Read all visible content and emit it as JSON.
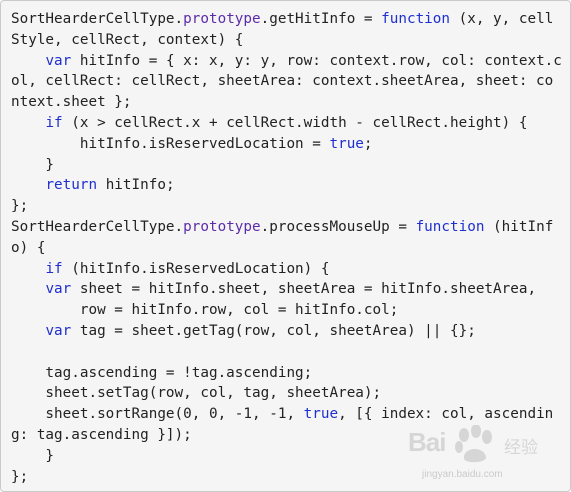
{
  "code": {
    "lines": [
      [
        {
          "t": "SortHearderCellType."
        },
        {
          "t": "prototype",
          "c": "prop"
        },
        {
          "t": ".getHitInfo = "
        },
        {
          "t": "function",
          "c": "keyword"
        },
        {
          "t": " (x, y, cell"
        }
      ],
      [
        {
          "t": "Style, cellRect, context) {"
        }
      ],
      [
        {
          "t": "    "
        },
        {
          "t": "var",
          "c": "keyword"
        },
        {
          "t": " hitInfo = { x: x, y: y, row: context.row, col: context.c"
        }
      ],
      [
        {
          "t": "ol, cellRect: cellRect, sheetArea: context.sheetArea, sheet: co"
        }
      ],
      [
        {
          "t": "ntext.sheet };"
        }
      ],
      [
        {
          "t": "    "
        },
        {
          "t": "if",
          "c": "keyword"
        },
        {
          "t": " (x > cellRect.x + cellRect.width - cellRect.height) {"
        }
      ],
      [
        {
          "t": "        hitInfo.isReservedLocation = "
        },
        {
          "t": "true",
          "c": "bool"
        },
        {
          "t": ";"
        }
      ],
      [
        {
          "t": "    }"
        }
      ],
      [
        {
          "t": "    "
        },
        {
          "t": "return",
          "c": "keyword"
        },
        {
          "t": " hitInfo;"
        }
      ],
      [
        {
          "t": "};"
        }
      ],
      [
        {
          "t": "SortHearderCellType."
        },
        {
          "t": "prototype",
          "c": "prop"
        },
        {
          "t": ".processMouseUp = "
        },
        {
          "t": "function",
          "c": "keyword"
        },
        {
          "t": " (hitInf"
        }
      ],
      [
        {
          "t": "o) {"
        }
      ],
      [
        {
          "t": "    "
        },
        {
          "t": "if",
          "c": "keyword"
        },
        {
          "t": " (hitInfo.isReservedLocation) {"
        }
      ],
      [
        {
          "t": "    "
        },
        {
          "t": "var",
          "c": "keyword"
        },
        {
          "t": " sheet = hitInfo.sheet, sheetArea = hitInfo.sheetArea,"
        }
      ],
      [
        {
          "t": "        row = hitInfo.row, col = hitInfo.col;"
        }
      ],
      [
        {
          "t": "    "
        },
        {
          "t": "var",
          "c": "keyword"
        },
        {
          "t": " tag = sheet.getTag(row, col, sheetArea) || {};"
        }
      ],
      [
        {
          "t": ""
        }
      ],
      [
        {
          "t": "    tag.ascending = !tag.ascending;"
        }
      ],
      [
        {
          "t": "    sheet.setTag(row, col, tag, sheetArea);"
        }
      ],
      [
        {
          "t": "    sheet.sortRange(0, 0, -1, -1, "
        },
        {
          "t": "true",
          "c": "bool"
        },
        {
          "t": ", [{ index: col, ascendin"
        }
      ],
      [
        {
          "t": "g: tag.ascending }]);"
        }
      ],
      [
        {
          "t": "    }"
        }
      ],
      [
        {
          "t": "};"
        }
      ]
    ]
  },
  "watermark": {
    "logo_text": "Bai",
    "logo_text_2": "",
    "jingyan_cn": "经验",
    "url": "jingyan.baidu.com"
  },
  "colors": {
    "keyword": "#1f2fd0",
    "prototype": "#5c2cab",
    "text": "#222222",
    "background": "#f5f5f5"
  }
}
